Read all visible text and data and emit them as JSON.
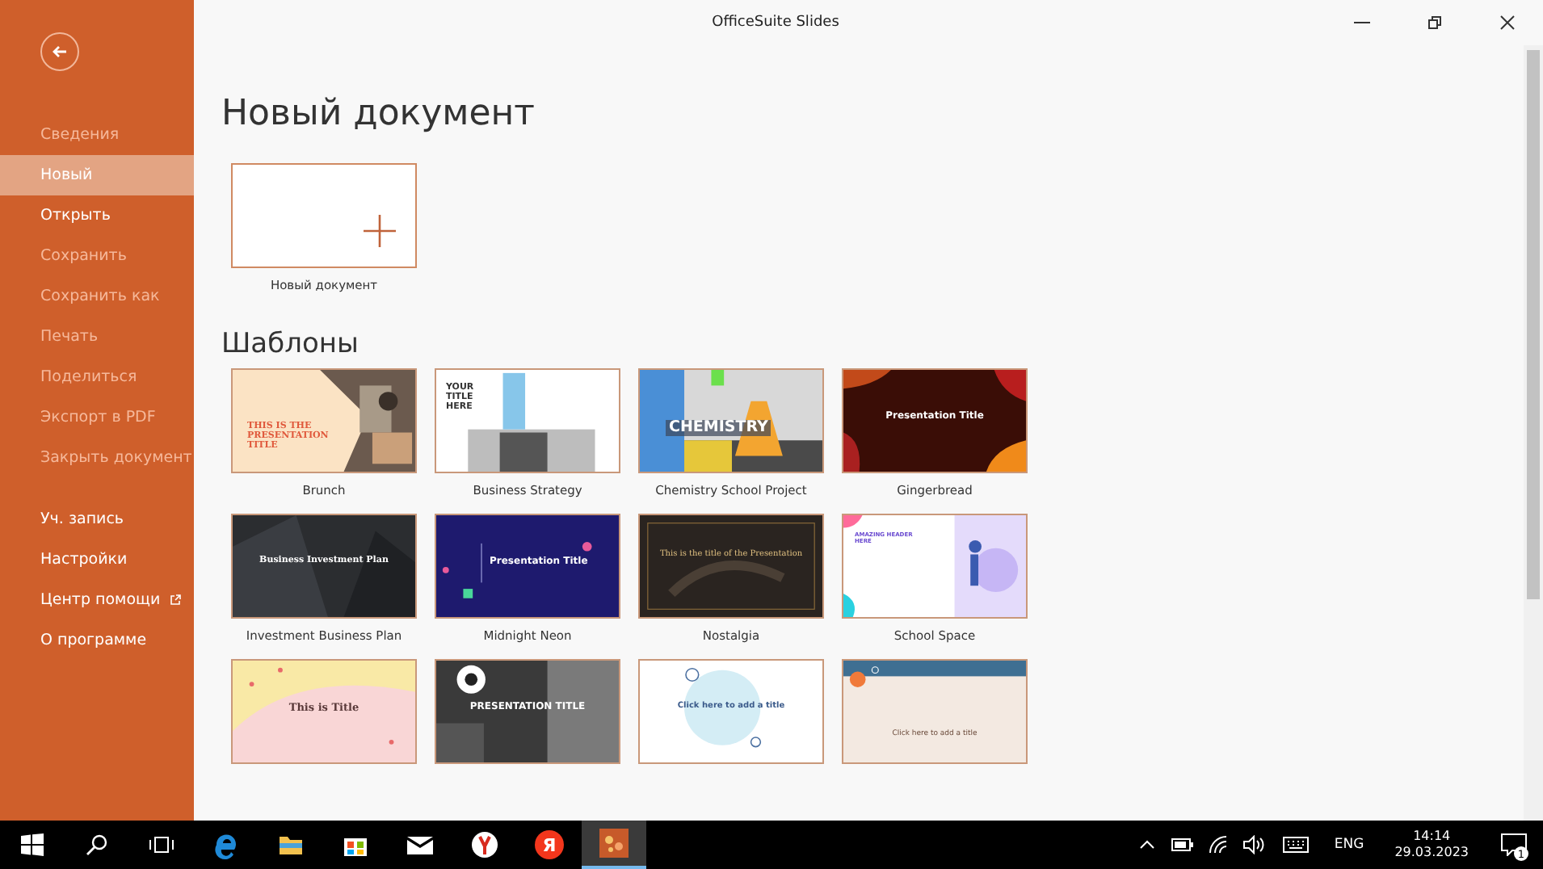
{
  "window": {
    "title": "OfficeSuite Slides"
  },
  "sidebar": {
    "items": [
      {
        "label": "Сведения",
        "disabled": true,
        "selected": false,
        "external": false
      },
      {
        "label": "Новый",
        "disabled": false,
        "selected": true,
        "external": false
      },
      {
        "label": "Открыть",
        "disabled": false,
        "selected": false,
        "external": false
      },
      {
        "label": "Сохранить",
        "disabled": true,
        "selected": false,
        "external": false
      },
      {
        "label": "Сохранить как",
        "disabled": true,
        "selected": false,
        "external": false
      },
      {
        "label": "Печать",
        "disabled": true,
        "selected": false,
        "external": false
      },
      {
        "label": "Поделиться",
        "disabled": true,
        "selected": false,
        "external": false
      },
      {
        "label": "Экспорт в PDF",
        "disabled": true,
        "selected": false,
        "external": false
      },
      {
        "label": "Закрыть документ",
        "disabled": true,
        "selected": false,
        "external": false
      }
    ],
    "bottom_items": [
      {
        "label": "Уч. запись",
        "disabled": false,
        "selected": false,
        "external": false
      },
      {
        "label": "Настройки",
        "disabled": false,
        "selected": false,
        "external": false
      },
      {
        "label": "Центр помощи",
        "disabled": false,
        "selected": false,
        "external": true
      },
      {
        "label": "О программе",
        "disabled": false,
        "selected": false,
        "external": false
      }
    ]
  },
  "heading": "Новый документ",
  "new_document": {
    "label": "Новый документ"
  },
  "templates_heading": "Шаблоны",
  "templates": [
    {
      "kind": "brunch",
      "title": "THIS IS THE PRESENTATION TITLE",
      "label": "Brunch"
    },
    {
      "kind": "strategy",
      "title": "YOUR TITLE HERE",
      "label": "Business Strategy"
    },
    {
      "kind": "chemistry",
      "title": "CHEMISTRY",
      "label": "Chemistry School Project"
    },
    {
      "kind": "gingerbread",
      "title": "Presentation Title",
      "label": "Gingerbread"
    },
    {
      "kind": "investment",
      "title": "Business Investment Plan",
      "label": "Investment Business Plan"
    },
    {
      "kind": "neon",
      "title": "Presentation Title",
      "label": "Midnight Neon"
    },
    {
      "kind": "nostalgia",
      "title": "This is the title of the Presentation",
      "label": "Nostalgia"
    },
    {
      "kind": "school",
      "title": "AMAZING HEADER HERE",
      "label": "School Space"
    },
    {
      "kind": "pastel",
      "title": "This is Title"
    },
    {
      "kind": "mono",
      "title": "PRESENTATION TITLE"
    },
    {
      "kind": "circle",
      "title": "Click here to add a title"
    },
    {
      "kind": "bulb",
      "title": "Click here to add a title"
    }
  ],
  "taskbar": {
    "apps": [
      {
        "kind": "edge",
        "selected": false
      },
      {
        "kind": "folder",
        "selected": false
      },
      {
        "kind": "store",
        "selected": false
      },
      {
        "kind": "mail",
        "selected": false
      },
      {
        "kind": "ybrowser",
        "selected": false
      },
      {
        "kind": "yandex",
        "selected": false,
        "glyph": "Я"
      },
      {
        "kind": "office",
        "selected": true
      }
    ],
    "language": "ENG",
    "time": "14:14",
    "date": "29.03.2023",
    "notifications": "1"
  }
}
